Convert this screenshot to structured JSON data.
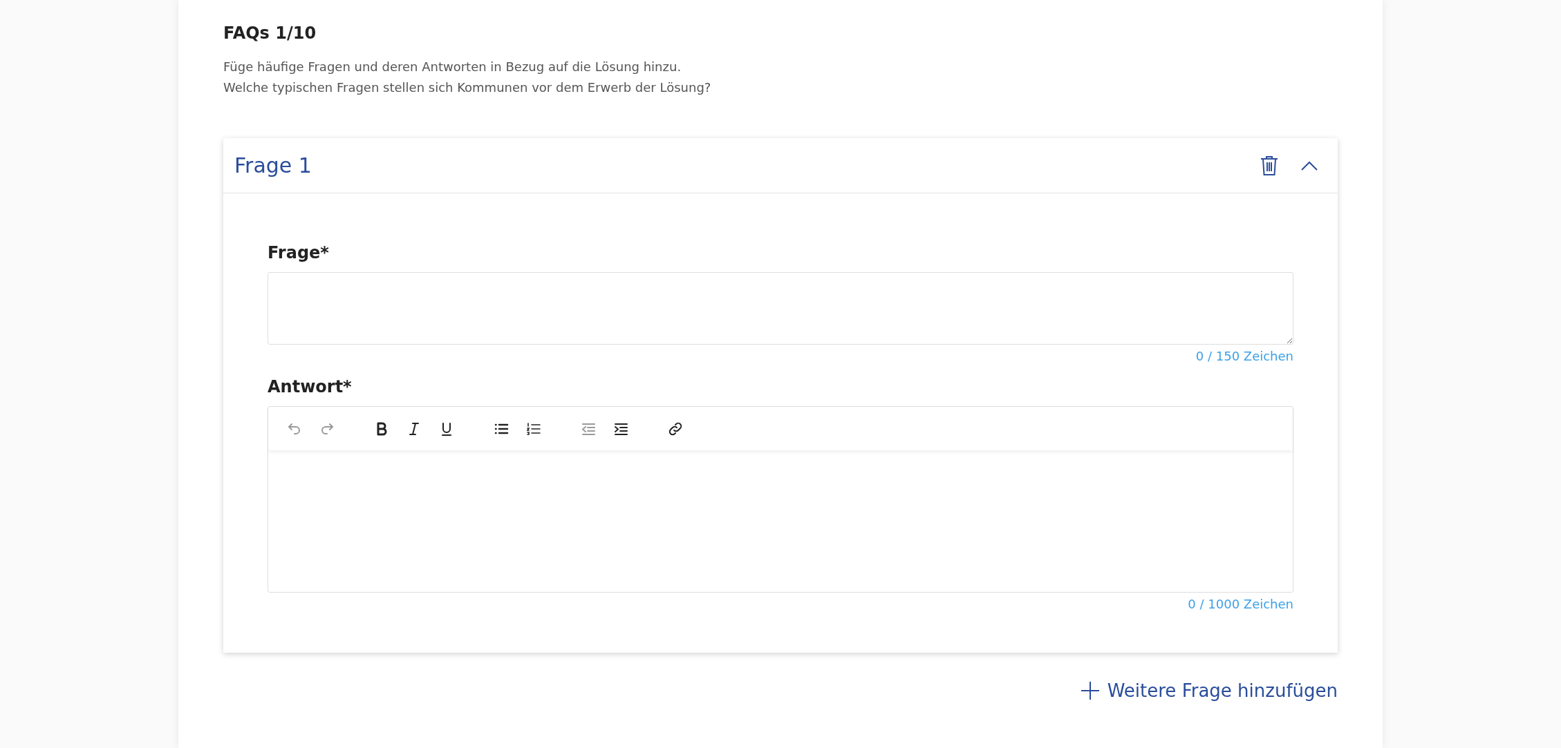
{
  "section": {
    "title": "FAQs 1/10",
    "description_lines": [
      "Füge häufige Fragen und deren Antworten in Bezug auf die Lösung hinzu.",
      "Welche typischen Fragen stellen sich Kommunen vor dem Erwerb der Lösung?"
    ]
  },
  "faqs": [
    {
      "title": "Frage 1",
      "expanded": true,
      "question": {
        "label": "Frage*",
        "counter": "0 / 150 Zeichen"
      },
      "answer": {
        "label": "Antwort*",
        "counter": "0 / 1000 Zeichen",
        "toolbar": [
          {
            "kind": "undo",
            "disabled": true
          },
          {
            "kind": "redo",
            "disabled": true
          },
          {
            "kind": "bold",
            "disabled": false
          },
          {
            "kind": "italic",
            "disabled": false
          },
          {
            "kind": "underline",
            "disabled": false
          },
          {
            "kind": "bullet-list",
            "disabled": false
          },
          {
            "kind": "numbered-list",
            "disabled": false
          },
          {
            "kind": "outdent",
            "disabled": true
          },
          {
            "kind": "indent",
            "disabled": false
          },
          {
            "kind": "link",
            "disabled": false
          }
        ]
      }
    }
  ],
  "add_button": {
    "label": "Weitere Frage hinzufügen"
  }
}
